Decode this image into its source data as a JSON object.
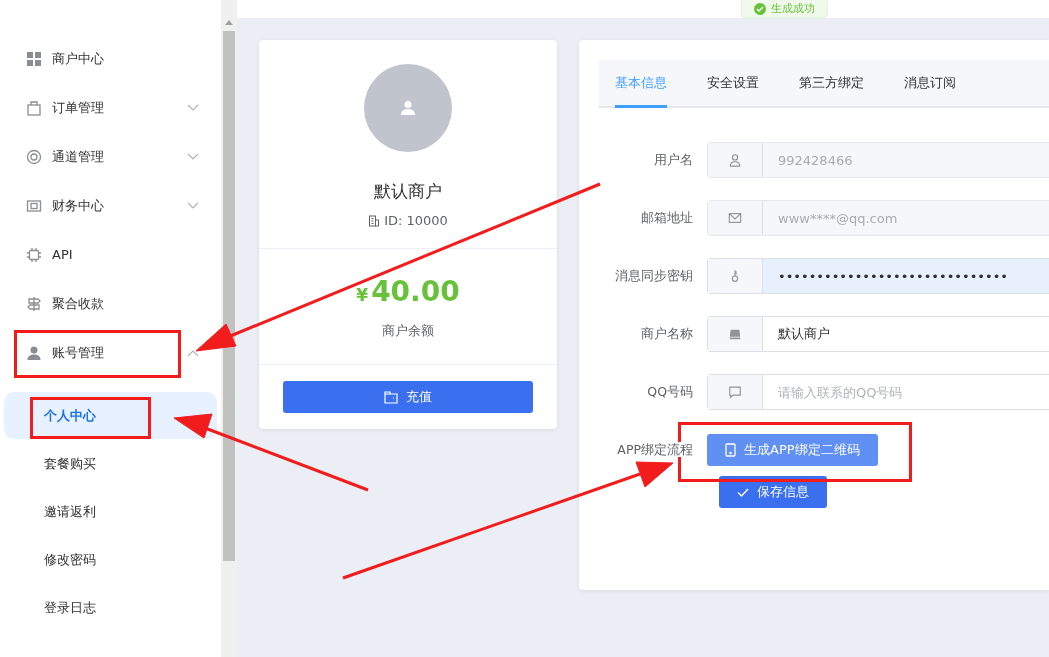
{
  "toast": {
    "text": "生成成功"
  },
  "sidebar": {
    "items": [
      {
        "label": "商户中心"
      },
      {
        "label": "订单管理",
        "expanded": false
      },
      {
        "label": "通道管理",
        "expanded": false
      },
      {
        "label": "财务中心",
        "expanded": false
      },
      {
        "label": "API"
      },
      {
        "label": "聚合收款"
      },
      {
        "label": "账号管理",
        "expanded": true,
        "children": [
          {
            "label": "个人中心",
            "selected": true
          },
          {
            "label": "套餐购买",
            "selected": false
          },
          {
            "label": "邀请返利",
            "selected": false
          },
          {
            "label": "修改密码",
            "selected": false
          },
          {
            "label": "登录日志",
            "selected": false
          }
        ]
      }
    ]
  },
  "profile": {
    "name": "默认商户",
    "id": "ID: 10000",
    "currency": "¥",
    "balance": "40.00",
    "balance_label": "商户余额",
    "recharge_button": "充值"
  },
  "tabs": [
    {
      "label": "基本信息",
      "selected": true
    },
    {
      "label": "安全设置",
      "selected": false
    },
    {
      "label": "第三方绑定",
      "selected": false
    },
    {
      "label": "消息订阅",
      "selected": false
    }
  ],
  "form": {
    "fields": [
      {
        "label": "用户名",
        "value": "992428466",
        "disabled": true,
        "autofilled": false
      },
      {
        "label": "邮箱地址",
        "value": "www****@qq.com",
        "disabled": true,
        "autofilled": false
      },
      {
        "label": "消息同步密钥",
        "value": "••••••••••••••••••••••••••••••",
        "disabled": false,
        "autofilled": true
      },
      {
        "label": "商户名称",
        "value": "默认商户",
        "disabled": false,
        "autofilled": false
      },
      {
        "label": "QQ号码",
        "placeholder": "请输入联系的QQ号码",
        "disabled": false,
        "autofilled": false
      }
    ],
    "app_label": "APP绑定流程",
    "app_button": "生成APP绑定二维码",
    "save_button": "保存信息"
  }
}
